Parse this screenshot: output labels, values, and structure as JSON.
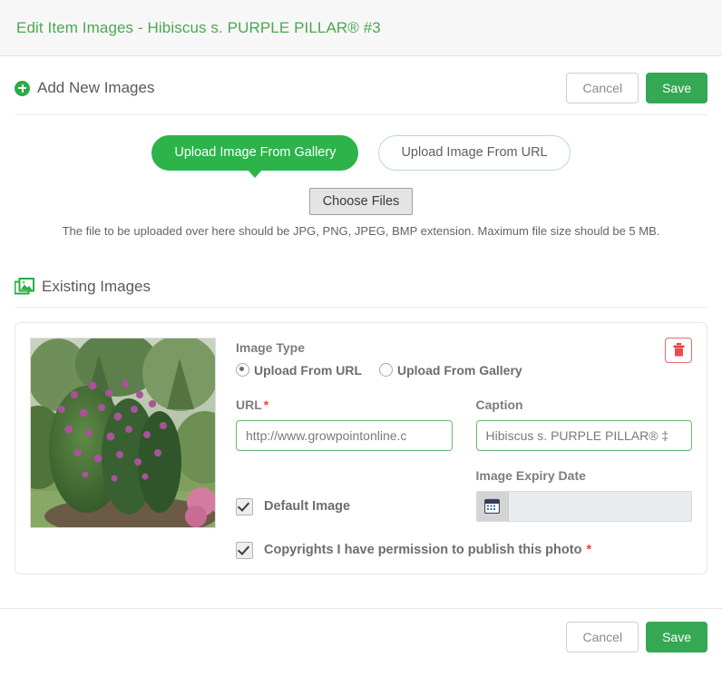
{
  "header": {
    "title": "Edit Item Images - Hibiscus s. PURPLE PILLAR® #3"
  },
  "add_new": {
    "section_title": "Add New Images",
    "plus_icon": "circle-plus-icon",
    "cancel_label": "Cancel",
    "save_label": "Save",
    "tabs": [
      {
        "label": "Upload Image From Gallery",
        "active": true
      },
      {
        "label": "Upload Image From URL",
        "active": false
      }
    ],
    "choose_files_label": "Choose Files",
    "help_text": "The file to be uploaded over here should be JPG, PNG, JPEG, BMP extension. Maximum file size should be 5 MB."
  },
  "existing": {
    "section_title": "Existing Images",
    "images_icon": "stacked-images-icon",
    "card": {
      "thumbnail_alt": "Hibiscus shrub with purple flowers in a garden",
      "delete_icon": "trash-icon",
      "image_type_label": "Image Type",
      "radios": [
        {
          "label": "Upload From URL",
          "checked": true
        },
        {
          "label": "Upload From Gallery",
          "checked": false
        }
      ],
      "url_label": "URL",
      "url_required_mark": "*",
      "url_value": "http://www.growpointonline.c",
      "caption_label": "Caption",
      "caption_value": "Hibiscus s. PURPLE PILLAR® ‡",
      "expiry_label": "Image Expiry Date",
      "expiry_value": "",
      "expiry_icon": "calendar-icon",
      "default_image_label": "Default Image",
      "default_image_checked": true,
      "copyright_label": "Copyrights I have permission to publish this photo",
      "copyright_required_mark": "*",
      "copyright_checked": true
    }
  },
  "footer": {
    "cancel_label": "Cancel",
    "save_label": "Save"
  },
  "colors": {
    "brand_green": "#35a853",
    "tab_green": "#2cb34a",
    "title_green": "#4aa84f",
    "required_red": "#e8473f",
    "delete_red": "#e46c6c",
    "input_border_green": "#66bb6a"
  }
}
